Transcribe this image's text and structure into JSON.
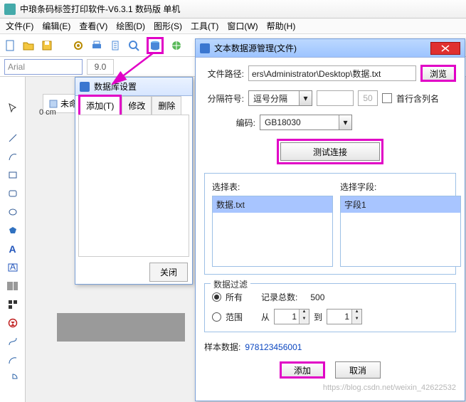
{
  "app": {
    "title": "中琅条码标签打印软件-V6.3.1 数码版 单机"
  },
  "menu": {
    "file": "文件(F)",
    "edit": "编辑(E)",
    "view": "查看(V)",
    "draw": "绘图(D)",
    "shape": "图形(S)",
    "tool": "工具(T)",
    "window": "窗口(W)",
    "help": "帮助(H)"
  },
  "fontbar": {
    "name": "Arial",
    "size": "9.0"
  },
  "tab": {
    "label": "未命"
  },
  "ruler": {
    "unit": "0 cm"
  },
  "dbDialog": {
    "title": "数据库设置",
    "tabs": {
      "add": "添加(T)",
      "modify": "修改",
      "delete": "删除"
    },
    "close": "关闭"
  },
  "dsDialog": {
    "title": "文本数据源管理(文件)",
    "labels": {
      "path": "文件路径:",
      "delim": "分隔符号:",
      "encoding": "编码:",
      "selectTable": "选择表:",
      "selectField": "选择字段:",
      "filter": "数据过滤",
      "all": "所有",
      "count": "记录总数:",
      "range": "范围",
      "from": "从",
      "to": "到",
      "sample": "样本数据:",
      "firstRow": "首行含列名"
    },
    "pathValue": "ers\\Administrator\\Desktop\\数据.txt",
    "browse": "浏览",
    "delimValue": "逗号分隔",
    "delimCount": "50",
    "encodingValue": "GB18030",
    "test": "测试连接",
    "table": "数据.txt",
    "field": "字段1",
    "recordCount": "500",
    "rangeFrom": "1",
    "rangeTo": "1",
    "sampleValue": "978123456001",
    "add": "添加",
    "cancel": "取消"
  },
  "watermark": "https://blog.csdn.net/weixin_42622532"
}
